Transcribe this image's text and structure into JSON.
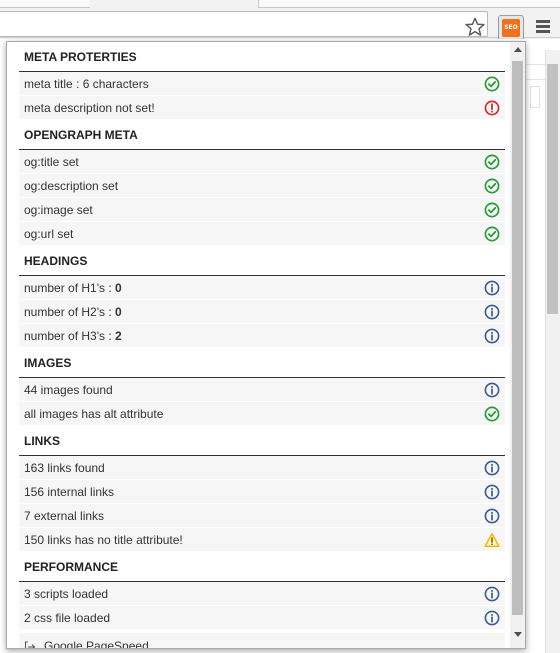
{
  "browser": {
    "extension_badge": "SEO",
    "colors": {
      "accent": "#f0711d",
      "ok": "#2b9a3a",
      "error": "#d0312d",
      "info": "#3b5a8c",
      "warning": "#e8b400"
    }
  },
  "sections": [
    {
      "title": "META PROTERTIES",
      "rows": [
        {
          "text": "meta title : 6 characters",
          "value": "",
          "status": "ok"
        },
        {
          "text": "meta description not set!",
          "value": "",
          "status": "error"
        }
      ]
    },
    {
      "title": "OPENGRAPH META",
      "rows": [
        {
          "text": "og:title set",
          "value": "",
          "status": "ok"
        },
        {
          "text": "og:description set",
          "value": "",
          "status": "ok"
        },
        {
          "text": "og:image set",
          "value": "",
          "status": "ok"
        },
        {
          "text": "og:url set",
          "value": "",
          "status": "ok"
        }
      ]
    },
    {
      "title": "HEADINGS",
      "rows": [
        {
          "text": "number of H1's : ",
          "value": "0",
          "status": "info"
        },
        {
          "text": "number of H2's : ",
          "value": "0",
          "status": "info"
        },
        {
          "text": "number of H3's : ",
          "value": "2",
          "status": "info"
        }
      ]
    },
    {
      "title": "IMAGES",
      "rows": [
        {
          "text": "44 images found",
          "value": "",
          "status": "info"
        },
        {
          "text": "all images has alt attribute",
          "value": "",
          "status": "ok"
        }
      ]
    },
    {
      "title": "LINKS",
      "rows": [
        {
          "text": "163 links found",
          "value": "",
          "status": "info"
        },
        {
          "text": "156 internal links",
          "value": "",
          "status": "info"
        },
        {
          "text": "7 external links",
          "value": "",
          "status": "info"
        },
        {
          "text": "150 links has no title attribute!",
          "value": "",
          "status": "warning"
        }
      ]
    },
    {
      "title": "PERFORMANCE",
      "rows": [
        {
          "text": "3 scripts loaded",
          "value": "",
          "status": "info"
        },
        {
          "text": "2 css file loaded",
          "value": "",
          "status": "info"
        }
      ]
    }
  ],
  "footer": {
    "link_label": "Google PageSpeed",
    "icon": "external-link-icon"
  }
}
